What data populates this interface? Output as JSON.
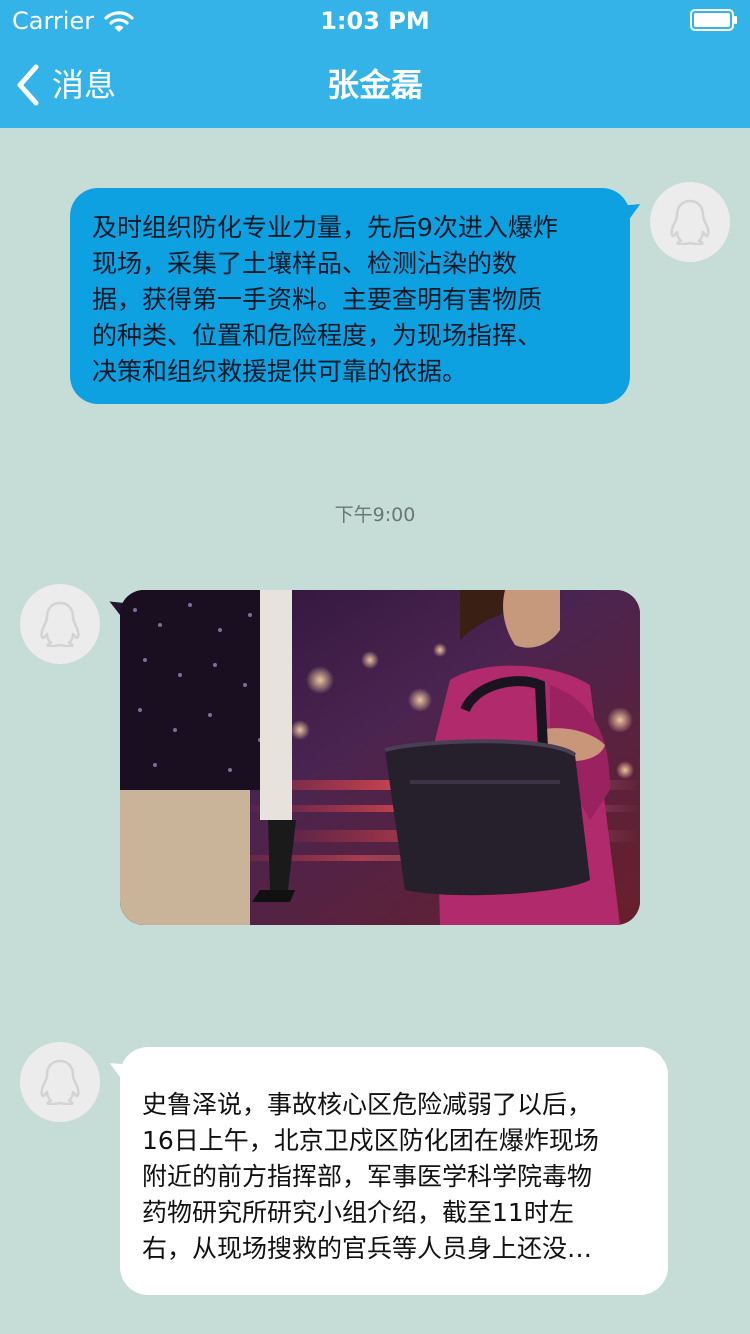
{
  "status_bar": {
    "carrier": "Carrier",
    "time": "1:03 PM"
  },
  "nav": {
    "back_label": "消息",
    "title": "张金磊"
  },
  "messages": [
    {
      "type": "text",
      "direction": "outgoing",
      "text": "及时组织防化专业力量，先后9次进入爆炸\n现场，采集了土壤样品、检测沾染的数\n据，获得第一手资料。主要查明有害物质\n的种类、位置和危险程度，为现场指挥、\n决策和组织救援提供可靠的依据。"
    },
    {
      "type": "timestamp",
      "text": "下午9:00"
    },
    {
      "type": "image",
      "direction": "incoming",
      "image": "photo-woman-with-handbag-night-street"
    },
    {
      "type": "text",
      "direction": "incoming",
      "text": "史鲁泽说，事故核心区危险减弱了以后，\n16日上午，北京卫戍区防化团在爆炸现场\n附近的前方指挥部，军事医学科学院毒物\n药物研究所研究小组介绍，截至11时左\n右，从现场搜救的官兵等人员身上还没…"
    }
  ],
  "colors": {
    "nav_bar": "#33b3e8",
    "background": "#c5ddd6",
    "outgoing_bubble": "#0ea1e2",
    "incoming_bubble": "#ffffff",
    "avatar": "#ececec"
  },
  "icons": {
    "back": "chevron-left-icon",
    "wifi": "wifi-icon",
    "battery": "battery-icon",
    "avatar": "qq-penguin-icon"
  }
}
